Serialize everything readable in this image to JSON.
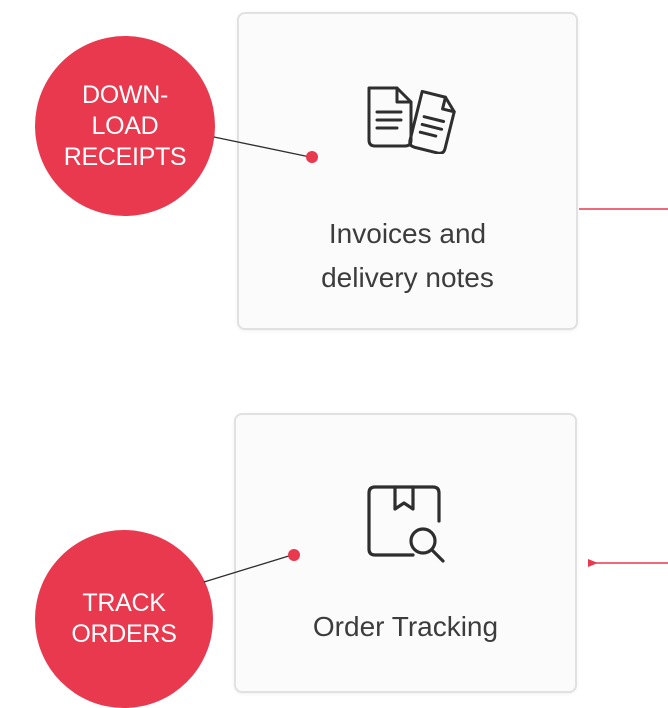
{
  "cards": {
    "invoices": {
      "label_line1": "Invoices and",
      "label_line2": "delivery notes",
      "icon": "documents-icon"
    },
    "tracking": {
      "label": "Order Tracking",
      "icon": "package-search-icon"
    }
  },
  "callouts": {
    "download": {
      "line1": "DOWN-",
      "line2": "LOAD",
      "line3": "RECEIPTS"
    },
    "track": {
      "line1": "TRACK",
      "line2": "ORDERS"
    }
  },
  "colors": {
    "accent": "#e8394f",
    "card_border": "#e1e1e1",
    "text": "#3c3c3c"
  }
}
